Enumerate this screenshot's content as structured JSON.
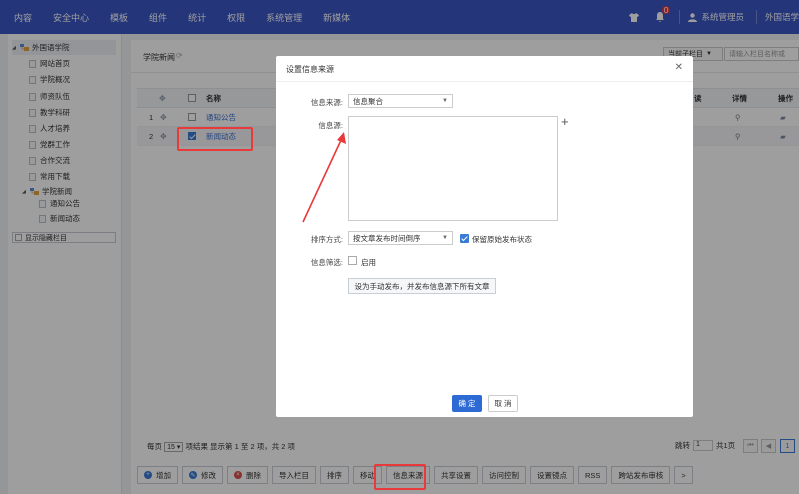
{
  "topnav": {
    "menu": [
      "内容",
      "安全中心",
      "模板",
      "组件",
      "统计",
      "权限",
      "系统管理",
      "新媒体"
    ],
    "notification_count": "0",
    "user_label": "系统管理员",
    "site_label": "外国语学"
  },
  "sidebar": {
    "root": "外国语学院",
    "items": [
      {
        "label": "网站首页",
        "type": "doc"
      },
      {
        "label": "学院概况",
        "type": "doc"
      },
      {
        "label": "师资队伍",
        "type": "doc"
      },
      {
        "label": "教学科研",
        "type": "doc"
      },
      {
        "label": "人才培养",
        "type": "doc"
      },
      {
        "label": "党群工作",
        "type": "doc"
      },
      {
        "label": "合作交流",
        "type": "doc"
      },
      {
        "label": "常用下载",
        "type": "doc"
      },
      {
        "label": "学院新闻",
        "type": "folder"
      }
    ],
    "sub_items": [
      "通知公告",
      "新闻动态"
    ],
    "show_hidden": "显示隐藏栏目"
  },
  "main": {
    "title": "学院新闻",
    "sub_column_select": "当前子栏目",
    "search_placeholder": "请输入栏目名称或",
    "columns": {
      "name": "名称",
      "read": "读",
      "detail": "详情",
      "ops": "操作"
    },
    "rows": [
      {
        "num": "1",
        "name": "通知公告",
        "checked": false
      },
      {
        "num": "2",
        "name": "新闻动态",
        "checked": true
      }
    ],
    "pager": {
      "per_page_label": "每页",
      "per_page": "15",
      "summary": "项结果 显示第 1 至 2 项，共 2 项",
      "goto_label": "跳转",
      "goto_value": "1",
      "total_pages": "共1页",
      "current": "1"
    },
    "toolbar": [
      "增加",
      "修改",
      "删除",
      "导入栏目",
      "排序",
      "移动",
      "信息来源",
      "共享设置",
      "访问控制",
      "设置镜点",
      "RSS",
      "跨站发布审核",
      ">"
    ]
  },
  "dialog": {
    "title": "设置信息来源",
    "source_label": "信息来源:",
    "source_value": "信息聚合",
    "info_source_label": "信息源:",
    "sort_label": "排序方式:",
    "sort_value": "按文章发布时间倒序",
    "keep_status": "保留原始发布状态",
    "filter_label": "信息筛选:",
    "filter_enable": "启用",
    "manual_button": "设为手动发布，并发布信息源下所有文章",
    "ok": "确 定",
    "cancel": "取 消"
  },
  "colors": {
    "nav": "#3a56c5",
    "accent": "#2d6ad3",
    "highlight": "#e83a3a"
  }
}
